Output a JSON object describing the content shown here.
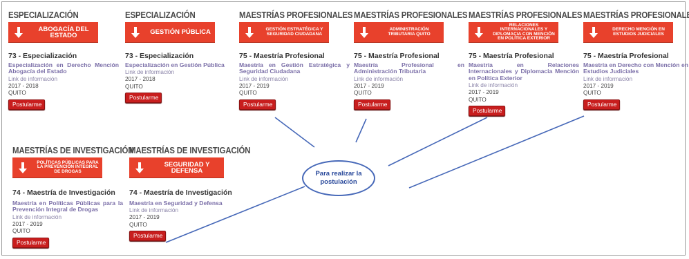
{
  "cards": [
    {
      "category": "ESPECIALIZACIÓN",
      "banner": "ABOGACÍA DEL ESTADO",
      "program": "73 - Especialización",
      "description": "Especialización en Derecho Mención Abogacía del Estado",
      "link": "Link de información",
      "years": "2017 - 2018",
      "city": "QUITO",
      "button": "Postularme"
    },
    {
      "category": "ESPECIALIZACIÓN",
      "banner": "GESTIÓN PÚBLICA",
      "program": "73 - Especialización",
      "description": "Especialización en Gestión Pública",
      "link": "Link de información",
      "years": "2017 - 2018",
      "city": "QUITO",
      "button": "Postularme"
    },
    {
      "category": "MAESTRÍAS PROFESIONALES",
      "banner": "GESTIÓN ESTRATÉGICA Y SEGURIDAD CIUDADANA",
      "program": "75 - Maestría Profesional",
      "description": "Maestría en Gestión Estratégica y Seguridad Ciudadana",
      "link": "Link de información",
      "years": "2017 - 2019",
      "city": "QUITO",
      "button": "Postularme"
    },
    {
      "category": "MAESTRÍAS PROFESIONALES",
      "banner": "ADMINISTRACIÓN TRIBUTARIA QUITO",
      "program": "75 - Maestría Profesional",
      "description": "Maestría Profesional en Administración Tributaria",
      "link": "Link de información",
      "years": "2017 - 2019",
      "city": "QUITO",
      "button": "Postularme"
    },
    {
      "category": "MAESTRÍAS PROFESIONALES",
      "banner": "RELACIONES INTERNACIONALES Y DIPLOMACIA CON MENCIÓN EN POLÍTICA EXTERIOR",
      "program": "75 - Maestría Profesional",
      "description": "Maestría en Relaciones Internacionales y Diplomacia Mención en Política Exterior",
      "link": "Link de información",
      "years": "2017 - 2019",
      "city": "QUITO",
      "button": "Postularme"
    },
    {
      "category": "MAESTRÍAS PROFESIONALES",
      "banner": "DERECHO MENCIÓN EN ESTUDIOS JUDICIALES",
      "program": "75 - Maestría Profesional",
      "description": "Maestría en Derecho con Mención en Estudios Judiciales",
      "link": "Link de información",
      "years": "2017 - 2019",
      "city": "QUITO",
      "button": "Postularme"
    },
    {
      "category": "MAESTRÍAS DE INVESTIGACIÓN",
      "banner": "POLÍTICAS PÚBLICAS PARA LA PREVENCIÓN INTEGRAL DE DROGAS",
      "program": "74 - Maestría de Investigación",
      "description": "Maestría en Políticas Públicas para la Prevención Integral de Drogas",
      "link": "Link de información",
      "years": "2017 - 2019",
      "city": "QUITO",
      "button": "Postularme"
    },
    {
      "category": "MAESTRÍAS DE INVESTIGACIÓN",
      "banner": "SEGURIDAD Y DEFENSA",
      "program": "74 - Maestría de Investigación",
      "description": "Maestría en Seguridad y Defensa",
      "link": "Link de información",
      "years": "2017 - 2019",
      "city": "QUITO",
      "button": "Postularme"
    }
  ],
  "callout": {
    "text": "Para realizar la postulación",
    "color": "#4668b8"
  },
  "colors": {
    "banner": "#e8412c",
    "button": "#c81e1e",
    "description": "#7b6fa8"
  }
}
